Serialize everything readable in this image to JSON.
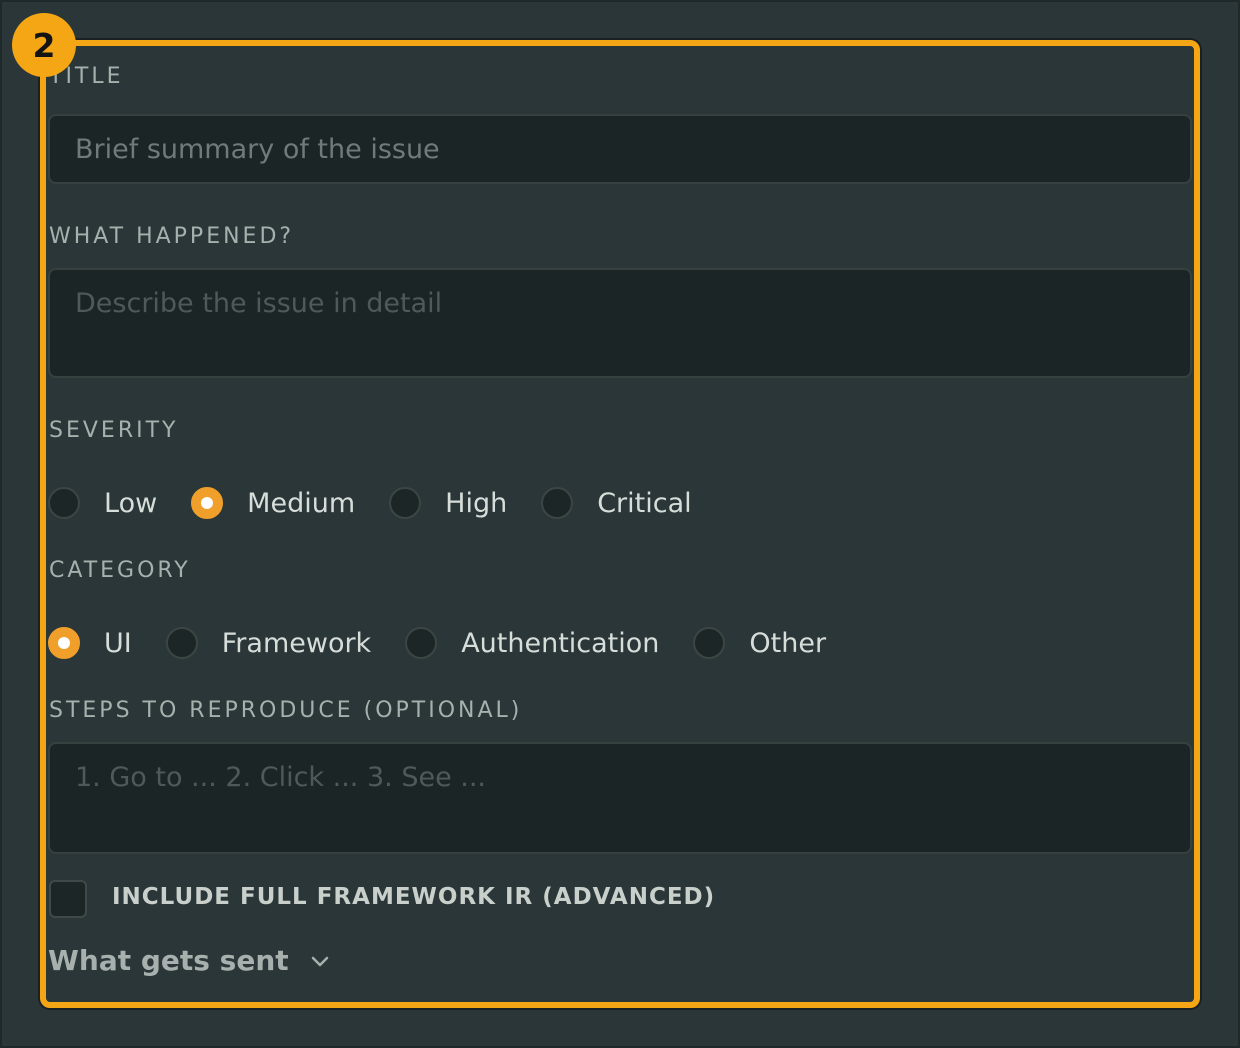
{
  "step_badge": "2",
  "title_field": {
    "label": "TITLE",
    "placeholder": "Brief summary of the issue"
  },
  "what_happened": {
    "label": "WHAT HAPPENED?",
    "placeholder": "Describe the issue in detail"
  },
  "severity": {
    "label": "SEVERITY",
    "options": [
      "Low",
      "Medium",
      "High",
      "Critical"
    ],
    "selected": "Medium"
  },
  "category": {
    "label": "CATEGORY",
    "options": [
      "UI",
      "Framework",
      "Authentication",
      "Other"
    ],
    "selected": "UI"
  },
  "steps": {
    "label": "STEPS TO REPRODUCE (OPTIONAL)",
    "placeholder": "1. Go to ... 2. Click ... 3. See ..."
  },
  "include_ir": {
    "label": "INCLUDE FULL FRAMEWORK IR (ADVANCED)",
    "checked": false
  },
  "disclosure": {
    "label": "What gets sent",
    "icon": "chevron-down-icon"
  },
  "colors": {
    "accent": "#f5a615",
    "background": "#2a3638",
    "input_background": "#1b2526"
  }
}
